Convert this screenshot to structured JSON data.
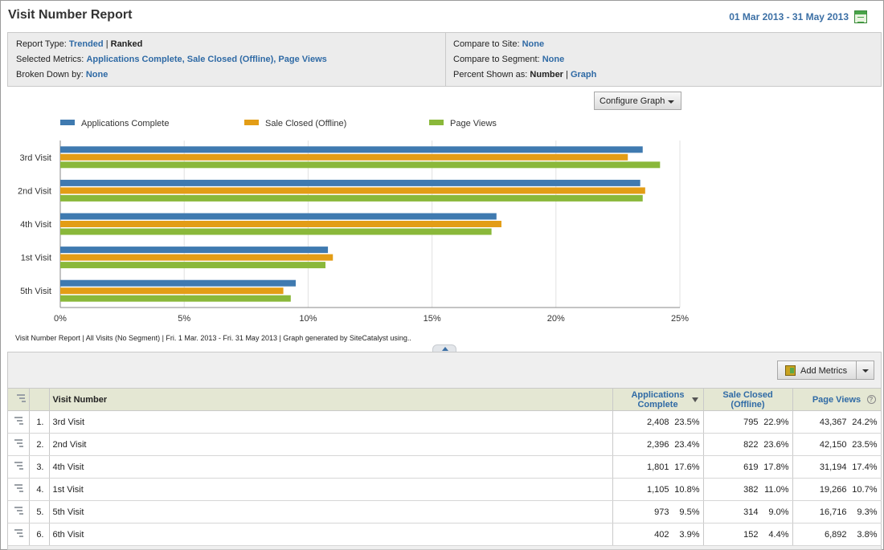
{
  "header": {
    "title": "Visit Number Report",
    "date_range": "01 Mar 2013 - 31 May 2013",
    "calendar_icon": "calendar-icon"
  },
  "settings": {
    "report_type_label": "Report Type:",
    "report_type_trended": "Trended",
    "separator": "|",
    "report_type_ranked": "Ranked",
    "selected_metrics_label": "Selected Metrics:",
    "selected_metrics_value": "Applications Complete, Sale Closed (Offline), Page Views",
    "broken_down_label": "Broken Down by:",
    "broken_down_value": "None",
    "compare_site_label": "Compare to Site:",
    "compare_site_value": "None",
    "compare_segment_label": "Compare to Segment:",
    "compare_segment_value": "None",
    "percent_shown_label": "Percent Shown as:",
    "percent_number": "Number",
    "percent_graph": "Graph"
  },
  "configure_graph_label": "Configure Graph",
  "footnote": "Visit Number Report | All Visits (No Segment) | Fri.  1 Mar. 2013 - Fri. 31 May 2013 | Graph generated by SiteCatalyst using..",
  "chart_data": {
    "type": "bar",
    "orientation": "horizontal",
    "categories": [
      "3rd Visit",
      "2nd Visit",
      "4th Visit",
      "1st Visit",
      "5th Visit"
    ],
    "series": [
      {
        "name": "Applications Complete",
        "color": "#3f7ab0",
        "values": [
          23.5,
          23.4,
          17.6,
          10.8,
          9.5
        ]
      },
      {
        "name": "Sale Closed (Offline)",
        "color": "#e39d16",
        "values": [
          22.9,
          23.6,
          17.8,
          11.0,
          9.0
        ]
      },
      {
        "name": "Page Views",
        "color": "#8ab83a",
        "values": [
          24.2,
          23.5,
          17.4,
          10.7,
          9.3
        ]
      }
    ],
    "xlim": [
      0,
      25
    ],
    "xticks": [
      "0%",
      "5%",
      "10%",
      "15%",
      "20%",
      "25%"
    ],
    "grid": true,
    "legend": "top"
  },
  "table": {
    "add_metrics_label": "Add Metrics",
    "headers": {
      "dimension": "Visit Number",
      "m1": "Applications Complete",
      "m2": "Sale Closed (Offline)",
      "m3": "Page Views",
      "help": "?"
    },
    "rows": [
      {
        "rank": "1.",
        "name": "3rd Visit",
        "m1": "2,408",
        "p1": "23.5%",
        "m2": "795",
        "p2": "22.9%",
        "m3": "43,367",
        "p3": "24.2%"
      },
      {
        "rank": "2.",
        "name": "2nd Visit",
        "m1": "2,396",
        "p1": "23.4%",
        "m2": "822",
        "p2": "23.6%",
        "m3": "42,150",
        "p3": "23.5%"
      },
      {
        "rank": "3.",
        "name": "4th Visit",
        "m1": "1,801",
        "p1": "17.6%",
        "m2": "619",
        "p2": "17.8%",
        "m3": "31,194",
        "p3": "17.4%"
      },
      {
        "rank": "4.",
        "name": "1st Visit",
        "m1": "1,105",
        "p1": "10.8%",
        "m2": "382",
        "p2": "11.0%",
        "m3": "19,266",
        "p3": "10.7%"
      },
      {
        "rank": "5.",
        "name": "5th Visit",
        "m1": "973",
        "p1": "9.5%",
        "m2": "314",
        "p2": "9.0%",
        "m3": "16,716",
        "p3": "9.3%"
      },
      {
        "rank": "6.",
        "name": "6th Visit",
        "m1": "402",
        "p1": "3.9%",
        "m2": "152",
        "p2": "4.4%",
        "m3": "6,892",
        "p3": "3.8%"
      }
    ]
  }
}
